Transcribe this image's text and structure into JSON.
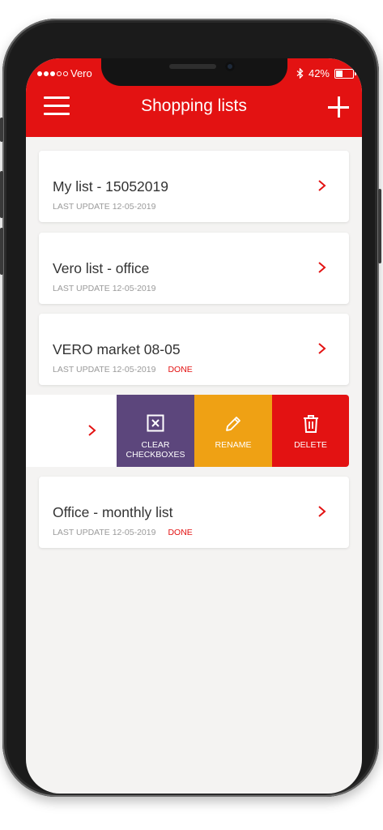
{
  "status_bar": {
    "carrier": "Vero",
    "battery": "42%"
  },
  "header": {
    "title": "Shopping lists"
  },
  "lists": [
    {
      "name": "My list - 15052019",
      "meta": "LAST UPDATE 12-05-2019",
      "status": ""
    },
    {
      "name": "Vero list - office",
      "meta": "LAST UPDATE 12-05-2019",
      "status": ""
    },
    {
      "name": "VERO market 08-05",
      "meta": "LAST UPDATE 12-05-2019",
      "status": "DONE"
    },
    {
      "name": "Office - monthly list",
      "meta": "LAST UPDATE 12-05-2019",
      "status": "DONE"
    }
  ],
  "swipe_actions": {
    "clear_line1": "CLEAR",
    "clear_line2": "CHECKBOXES",
    "rename": "RENAME",
    "delete": "DELETE"
  },
  "icons": {
    "menu": "hamburger-icon",
    "add": "plus-icon",
    "chevron": "chevron-right-icon",
    "clear": "x-square-icon",
    "rename": "pencil-icon",
    "delete": "trash-icon",
    "bluetooth": "bluetooth-icon",
    "battery": "battery-icon"
  },
  "colors": {
    "accent": "#e31212",
    "clear_action": "#5c467c",
    "rename_action": "#efa114",
    "delete_action": "#e31212",
    "background": "#f4f3f2"
  }
}
